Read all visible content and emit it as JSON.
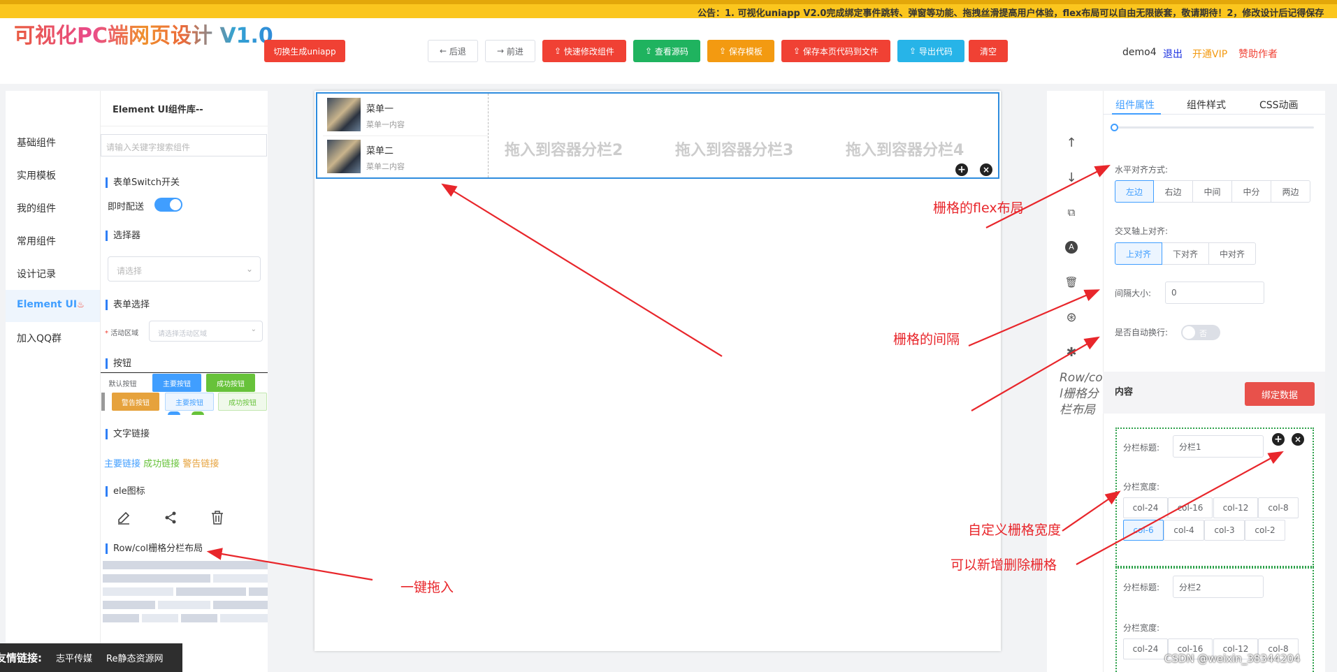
{
  "notice": "公告：1. 可视化uniapp V2.0完成绑定事件跳转、弹窗等功能、拖拽丝滑提高用户体验，flex布局可以自由无限嵌套，敬请期待！2，修改设计后记得保存",
  "header": {
    "logo": "可视化PC端网页设计 V1.0",
    "switch_btn": "切换生成uniapp",
    "back": "后退",
    "forward": "前进",
    "quick_edit": "快速修改组件",
    "view_source": "查看源码",
    "save_template": "保存模板",
    "save_file": "保存本页代码到文件",
    "export": "导出代码",
    "clear": "清空",
    "user": "demo4",
    "logout": "退出",
    "vip": "开通VIP",
    "sponsor": "赞助作者"
  },
  "nav": [
    "基础组件",
    "实用模板",
    "我的组件",
    "常用组件",
    "设计记录",
    "Element UI",
    "加入QQ群"
  ],
  "library": {
    "title": "Element UI组件库--",
    "search_placeholder": "请输入关键字搜索组件",
    "switch_section": "表单Switch开关",
    "switch_label": "即时配送",
    "select_section": "选择器",
    "select_placeholder": "请选择",
    "form_select_section": "表单选择",
    "form_label": "活动区域",
    "form_placeholder": "请选择活动区域",
    "button_section": "按钮",
    "buttons_row1": [
      "默认按钮",
      "主要按钮",
      "成功按钮"
    ],
    "buttons_row2": [
      "警告按钮",
      "主要按钮",
      "成功按钮"
    ],
    "link_section": "文字链接",
    "links": [
      "主要链接",
      "成功链接",
      "警告链接"
    ],
    "icon_section": "ele图标",
    "grid_section": "Row/col栅格分栏布局"
  },
  "friend_links": {
    "label": "友情链接:",
    "items": [
      "志平传媒",
      "Re静态资源网"
    ]
  },
  "canvas": {
    "menu1_title": "菜单一",
    "menu1_sub": "菜单一内容",
    "menu2_title": "菜单二",
    "menu2_sub": "菜单二内容",
    "drop2": "拖入到容器分栏2",
    "drop3": "拖入到容器分栏3",
    "drop4": "拖入到容器分栏4"
  },
  "tool_caption": "Row/col栅格分栏布局",
  "props": {
    "tabs": [
      "组件属性",
      "组件样式",
      "CSS动画"
    ],
    "h_align_label": "水平对齐方式:",
    "h_align": [
      "左边",
      "右边",
      "中间",
      "中分",
      "两边"
    ],
    "v_align_label": "交叉轴上对齐:",
    "v_align": [
      "上对齐",
      "下对齐",
      "中对齐"
    ],
    "gap_label": "间隔大小:",
    "gap_value": "0",
    "wrap_label": "是否自动换行:",
    "wrap_value": "否",
    "content_label": "内容",
    "bind_btn": "绑定数据",
    "col_title_label": "分栏标题:",
    "col1_title": "分栏1",
    "col2_title": "分栏2",
    "width_label": "分栏宽度:",
    "widths": [
      "col-24",
      "col-16",
      "col-12",
      "col-8",
      "col-6",
      "col-4",
      "col-3",
      "col-2"
    ]
  },
  "annotations": {
    "flex": "栅格的flex布局",
    "gap": "栅格的间隔",
    "drag": "一键拖入",
    "width": "自定义栅格宽度",
    "add_del": "可以新增删除栅格"
  },
  "watermark": "CSDN @weixin_38344204",
  "colors": {
    "primary": "#409eff",
    "danger": "#f04134",
    "success": "#1fb35f",
    "warning": "#f39a11",
    "info": "#27b4e8",
    "annot": "#e8262b"
  }
}
